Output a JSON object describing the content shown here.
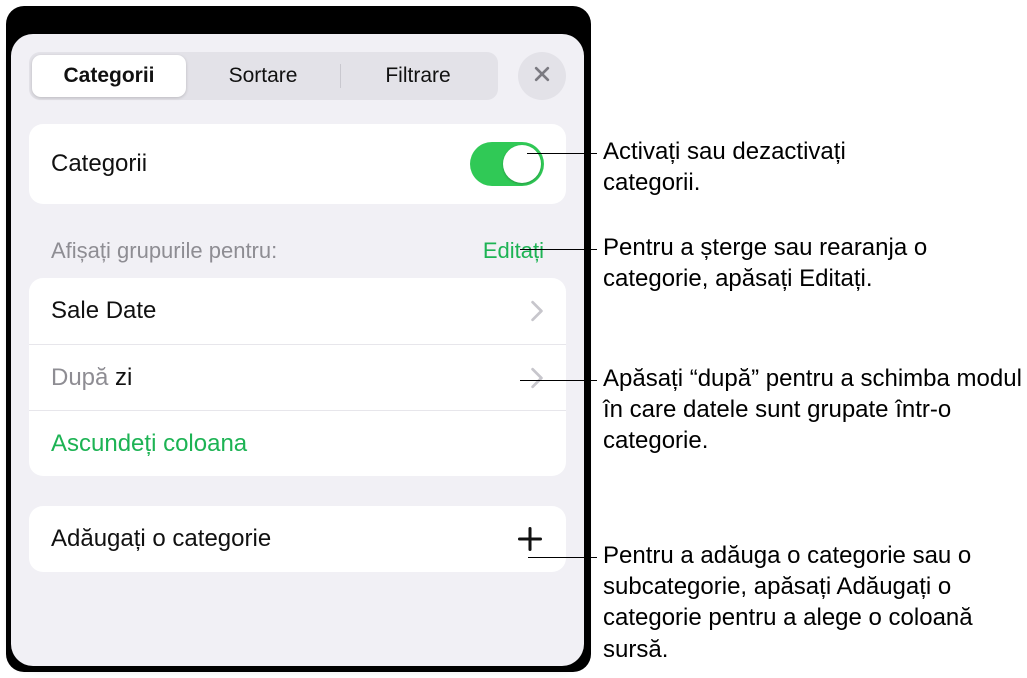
{
  "tabs": {
    "categories": "Categorii",
    "sort": "Sortare",
    "filter": "Filtrare"
  },
  "categories_card": {
    "label": "Categorii"
  },
  "groups_section": {
    "header": "Afișați grupurile pentru:",
    "edit": "Editați",
    "rows": {
      "sale_date": "Sale Date",
      "by_prefix": "După ",
      "by_value": "zi",
      "hide_column": "Ascundeți coloana"
    }
  },
  "add_category": {
    "label": "Adăugați o categorie"
  },
  "callouts": {
    "toggle": "Activați sau dezactivați categorii.",
    "edit": "Pentru a șterge sau rearanja o categorie, apăsați Editați.",
    "by": "Apăsați “după” pentru a schimba modul în care datele sunt grupate într-o categorie.",
    "add": "Pentru a adăuga o categorie sau o subcategorie, apăsați Adăugați o categorie pentru a alege o coloană sursă."
  }
}
